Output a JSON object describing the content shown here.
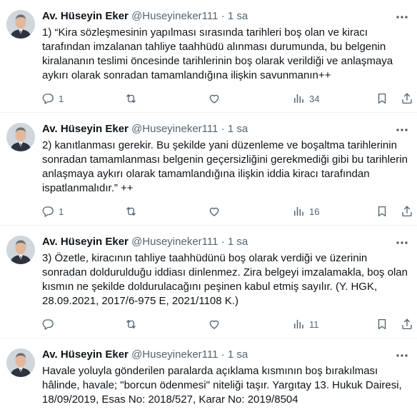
{
  "tweets": [
    {
      "name": "Av. Hüseyin Eker",
      "handle": "@Huseyineker111",
      "dot": "·",
      "time": "1 sa",
      "text": "1) “Kira sözleşmesinin yapılması sırasında tarihleri boş olan ve kiracı tarafından imzalanan tahliye taahhüdü alınması durumunda, bu belgenin kiralananın teslimi öncesinde tarihlerinin boş olarak verildiği ve anlaşmaya aykırı olarak sonradan tamamlandığına ilişkin savunmanın++",
      "reply_count": "1",
      "retweet_count": "",
      "like_count": "",
      "views": "34"
    },
    {
      "name": "Av. Hüseyin Eker",
      "handle": "@Huseyineker111",
      "dot": "·",
      "time": "1 sa",
      "text": "2) kanıtlanması gerekir. Bu şekilde yani düzenleme ve boşaltma tarihlerinin sonradan tamamlanması belgenin geçersizliğini gerekmediği gibi bu tarihlerin anlaşmaya aykırı olarak tamamlandığına ilişkin iddia kiracı tarafından ispatlanmalıdır.” ++",
      "reply_count": "1",
      "retweet_count": "",
      "like_count": "",
      "views": "16"
    },
    {
      "name": "Av. Hüseyin Eker",
      "handle": "@Huseyineker111",
      "dot": "·",
      "time": "1 sa",
      "text": "3) Özetle, kiracının tahliye taahhüdünü boş olarak verdiği ve üzerinin sonradan doldurulduğu iddiası dinlenmez. Zira belgeyi imzalamakla, boş olan kısmın ne şekilde doldurulacağını peşinen kabul etmiş sayılır. (Y. HGK, 28.09.2021, 2017/6-975 E, 2021/1108 K.)",
      "reply_count": "",
      "retweet_count": "",
      "like_count": "",
      "views": "11"
    },
    {
      "name": "Av. Hüseyin Eker",
      "handle": "@Huseyineker111",
      "dot": "·",
      "time": "1 sa",
      "text": "Havale yoluyla gönderilen paralarda açıklama kısmının boş bırakılması hâlinde, havale; \"borcun ödenmesi\" niteliği taşır. Yargıtay 13. Hukuk Dairesi, 18/09/2019, Esas No: 2018/527, Karar No: 2019/8504"
    }
  ],
  "icons": {
    "reply": "reply-icon",
    "retweet": "retweet-icon",
    "like": "like-icon",
    "views": "views-icon",
    "bookmark": "bookmark-icon",
    "share": "share-icon",
    "more": "more-icon"
  },
  "colors": {
    "text": "#0f1419",
    "secondary": "#536471",
    "divider": "#eff3f4"
  }
}
